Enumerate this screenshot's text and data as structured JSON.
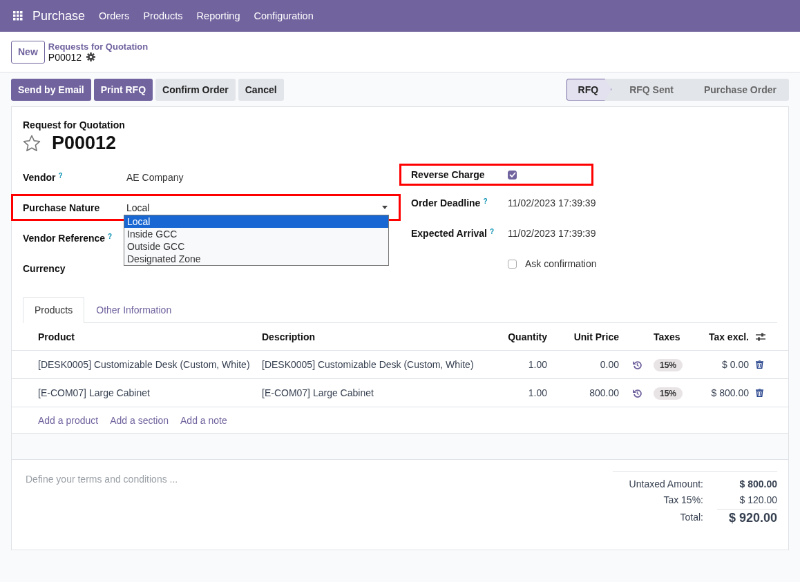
{
  "navbar": {
    "app": "Purchase",
    "menus": [
      "Orders",
      "Products",
      "Reporting",
      "Configuration"
    ]
  },
  "breadcrumb": {
    "new_button": "New",
    "parent": "Requests for Quotation",
    "current": "P00012"
  },
  "actions": [
    {
      "label": "Send by Email",
      "kind": "primary"
    },
    {
      "label": "Print RFQ",
      "kind": "primary"
    },
    {
      "label": "Confirm Order",
      "kind": "secondary"
    },
    {
      "label": "Cancel",
      "kind": "secondary"
    }
  ],
  "statusbar": [
    {
      "label": "RFQ",
      "selected": true
    },
    {
      "label": "RFQ Sent",
      "selected": false
    },
    {
      "label": "Purchase Order",
      "selected": false
    }
  ],
  "form": {
    "subtitle": "Request for Quotation",
    "title": "P00012",
    "starred": false,
    "left_fields": [
      {
        "label": "Vendor",
        "help": "?",
        "kind": "text",
        "value": "AE Company",
        "highlighted": false
      },
      {
        "label": "Purchase Nature",
        "kind": "select",
        "value": "Local",
        "highlighted": true,
        "expanded": true,
        "options": [
          {
            "label": "Local",
            "selected": true
          },
          {
            "label": "Inside GCC",
            "selected": false
          },
          {
            "label": "Outside GCC",
            "selected": false
          },
          {
            "label": "Designated Zone",
            "selected": false
          }
        ]
      },
      {
        "label": "Vendor Reference",
        "help": "?",
        "kind": "text",
        "highlighted": false
      },
      {
        "label": "Currency",
        "kind": "text",
        "highlighted": false
      }
    ],
    "right_fields": [
      {
        "label": "Reverse Charge",
        "kind": "checkbox",
        "checked": true,
        "highlighted": true
      },
      {
        "label": "Order Deadline",
        "help": "?",
        "kind": "text",
        "value": "11/02/2023 17:39:39",
        "highlighted": false
      },
      {
        "label": "Expected Arrival",
        "help": "?",
        "kind": "text",
        "value": "11/02/2023 17:39:39",
        "highlighted": false
      },
      {
        "label": "Ask confirmation",
        "kind": "inline_checkbox",
        "checked": false,
        "highlighted": false
      }
    ]
  },
  "tabs": [
    {
      "label": "Products",
      "selected": true
    },
    {
      "label": "Other Information",
      "selected": false
    }
  ],
  "table": {
    "columns": [
      "Product",
      "Description",
      "Quantity",
      "Unit Price",
      "Taxes",
      "Tax excl."
    ],
    "rows": [
      {
        "product": "[DESK0005] Customizable Desk (Custom, White)",
        "description": "[DESK0005] Customizable Desk (Custom, White)",
        "quantity": "1.00",
        "unit_price": "0.00",
        "taxes": "15%",
        "subtotal": "$ 0.00"
      },
      {
        "product": "[E-COM07] Large Cabinet",
        "description": "[E-COM07] Large Cabinet",
        "quantity": "1.00",
        "unit_price": "800.00",
        "taxes": "15%",
        "subtotal": "$ 800.00"
      }
    ],
    "add_links": [
      "Add a product",
      "Add a section",
      "Add a note"
    ]
  },
  "terms": {
    "placeholder": "Define your terms and conditions ..."
  },
  "totals": [
    {
      "label": "Untaxed Amount:",
      "value": "$ 800.00",
      "kind": "bold"
    },
    {
      "label": "Tax 15%:",
      "value": "$ 120.00",
      "kind": "normal"
    },
    {
      "label": "Total:",
      "value": "$ 920.00",
      "kind": "grand"
    }
  ]
}
